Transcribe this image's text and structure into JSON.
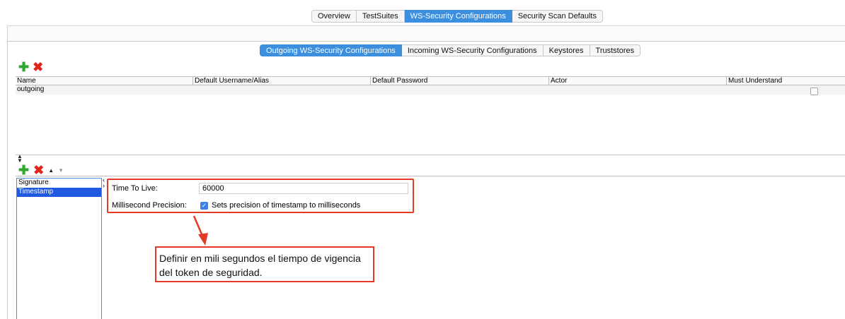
{
  "top_tabs": [
    "Overview",
    "TestSuites",
    "WS-Security Configurations",
    "Security Scan Defaults"
  ],
  "sub_tabs": [
    "Outgoing WS-Security Configurations",
    "Incoming WS-Security Configurations",
    "Keystores",
    "Truststores"
  ],
  "table": {
    "columns": [
      "Name",
      "Default Username/Alias",
      "Default Password",
      "Actor",
      "Must Understand"
    ],
    "rows": [
      {
        "name": "outgoing",
        "username": "",
        "password": "",
        "actor": "",
        "must_understand": false
      }
    ]
  },
  "entries": [
    "Signature",
    "Timestamp"
  ],
  "timestamp_form": {
    "ttl_label": "Time To Live:",
    "ttl_value": "60000",
    "ms_label": "Millisecond Precision:",
    "ms_checked": true,
    "ms_text": "Sets precision of timestamp to milliseconds"
  },
  "annotation": {
    "line1": "Definir en mili segundos el tiempo de vigencia",
    "line2": "del token de seguridad."
  },
  "colors": {
    "accent": "#3b8fde",
    "highlight": "#e33a26",
    "selection": "#1f5ae0",
    "add": "#2fa82f",
    "remove": "#e2231a"
  }
}
